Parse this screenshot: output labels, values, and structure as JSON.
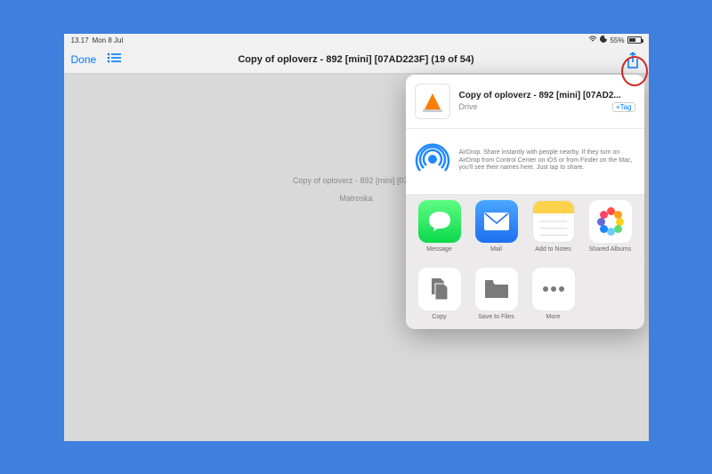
{
  "status": {
    "time": "13.17",
    "date": "Mon 8 Jul",
    "battery_pct": "55%"
  },
  "nav": {
    "done": "Done",
    "title": "Copy of oploverz - 892 [mini] [07AD223F] (19 of 54)"
  },
  "preview": {
    "filename": "Copy of oploverz - 892 [mini] [07AD",
    "filetype": "Matroska"
  },
  "sheet": {
    "file_title": "Copy of oploverz - 892 [mini] [07AD2...",
    "source": "Drive",
    "tag_label": "+Tag",
    "airdrop": "AirDrop. Share instantly with people nearby. If they turn on AirDrop from Control Center on iOS or from Finder on the Mac, you'll see their names here. Just tap to share.",
    "apps": [
      {
        "label": "Message"
      },
      {
        "label": "Mail"
      },
      {
        "label": "Add to Notes"
      },
      {
        "label": "Shared Albums"
      }
    ],
    "actions": [
      {
        "label": "Copy"
      },
      {
        "label": "Save to Files"
      },
      {
        "label": "More"
      }
    ]
  }
}
